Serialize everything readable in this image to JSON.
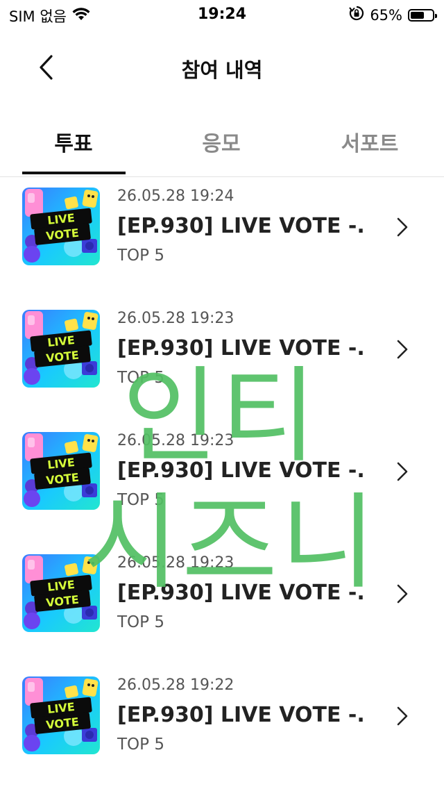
{
  "status_bar": {
    "carrier": "SIM 없음",
    "time": "19:24",
    "battery_percent": "65%",
    "battery_level": 0.65,
    "icons": [
      "wifi-icon",
      "orientation-lock-icon",
      "battery-icon"
    ]
  },
  "header": {
    "title": "참여 내역",
    "back_icon": "chevron-left-icon"
  },
  "tabs": [
    {
      "label": "투표",
      "active": true
    },
    {
      "label": "응모",
      "active": false
    },
    {
      "label": "서포트",
      "active": false
    }
  ],
  "items": [
    {
      "date": "26.05.28 19:24",
      "title": "[EP.930] LIVE VOTE -...",
      "subtitle": "TOP 5",
      "thumb_lines": [
        "LIVE",
        "VOTE"
      ]
    },
    {
      "date": "26.05.28 19:23",
      "title": "[EP.930] LIVE VOTE -...",
      "subtitle": "TOP 5",
      "thumb_lines": [
        "LIVE",
        "VOTE"
      ]
    },
    {
      "date": "26.05.28 19:23",
      "title": "[EP.930] LIVE VOTE -...",
      "subtitle": "TOP 5",
      "thumb_lines": [
        "LIVE",
        "VOTE"
      ]
    },
    {
      "date": "26.05.28 19:23",
      "title": "[EP.930] LIVE VOTE -...",
      "subtitle": "TOP 5",
      "thumb_lines": [
        "LIVE",
        "VOTE"
      ]
    },
    {
      "date": "26.05.28 19:22",
      "title": "[EP.930] LIVE VOTE -...",
      "subtitle": "TOP 5",
      "thumb_lines": [
        "LIVE",
        "VOTE"
      ]
    }
  ],
  "watermark": {
    "line1": "인티",
    "line2": "시즈니",
    "color": "#52c063"
  },
  "colors": {
    "text_primary": "#111111",
    "text_secondary": "#555555",
    "tab_inactive": "#8a8a8a"
  }
}
